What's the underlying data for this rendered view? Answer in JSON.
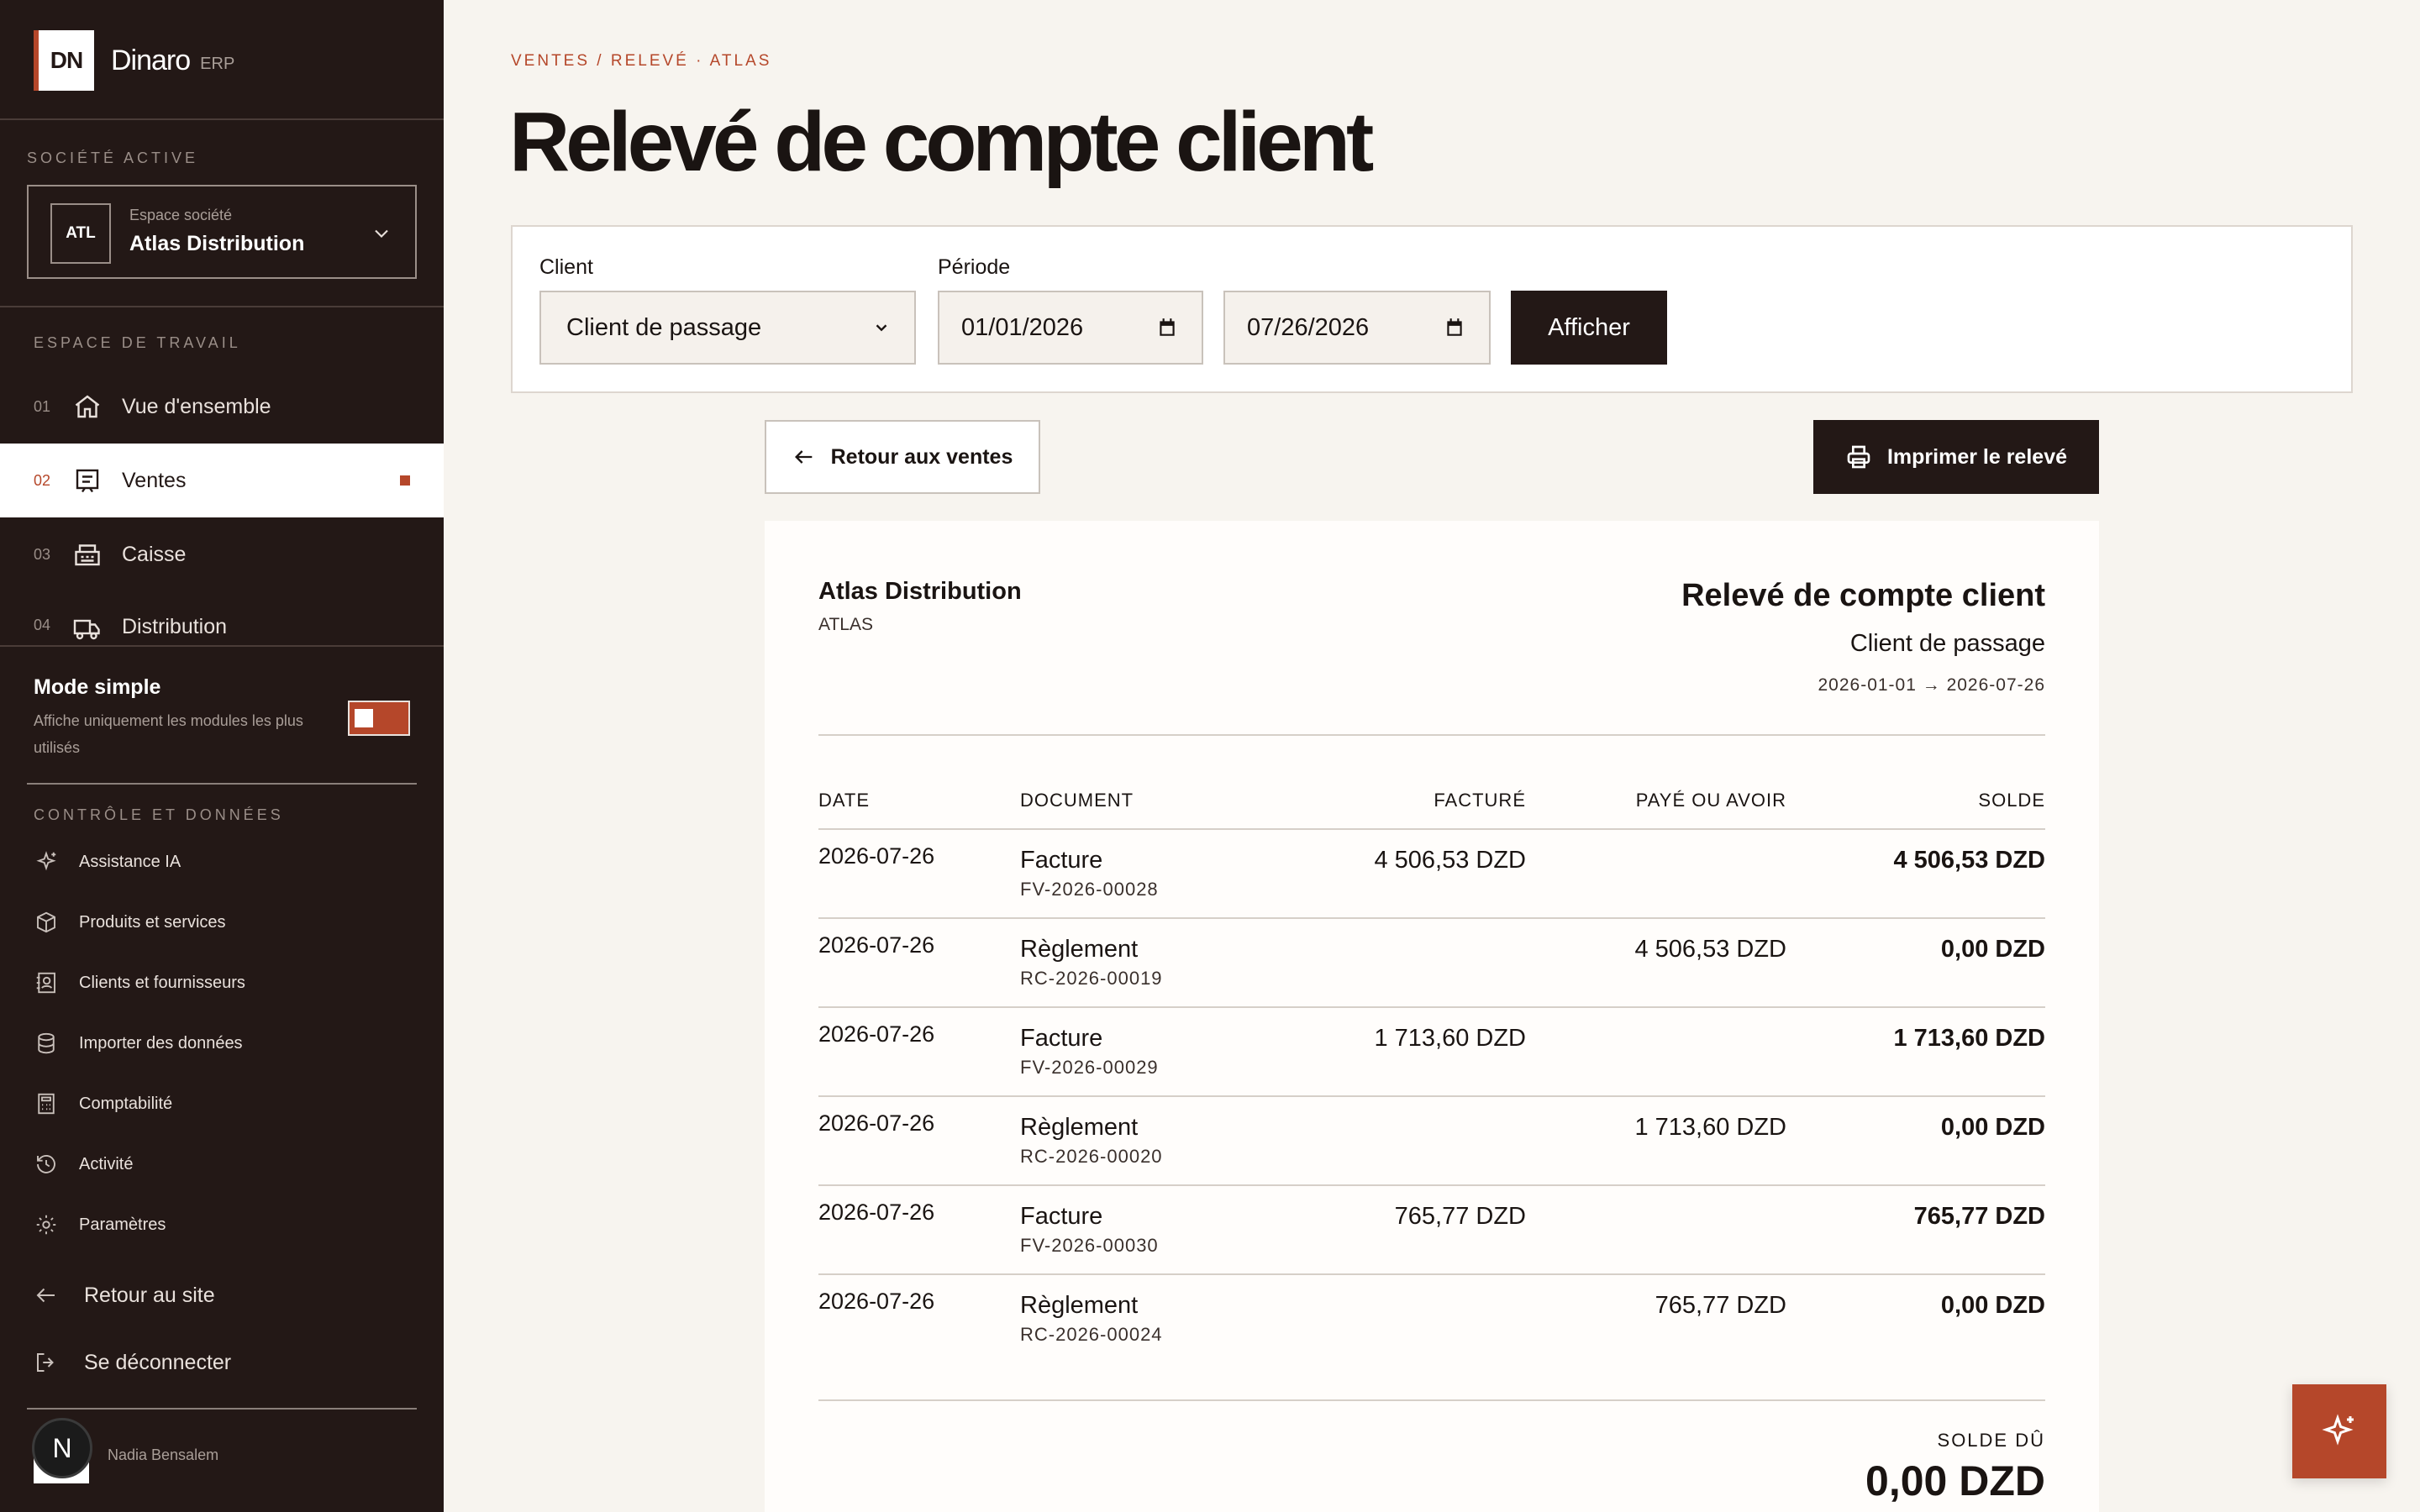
{
  "colors": {
    "accent": "#b5472a",
    "sidebar_bg": "#231816",
    "page_bg": "#f7f4ef"
  },
  "brand": {
    "logo": "DN",
    "name": "Dinaro",
    "tag": "ERP"
  },
  "company": {
    "section_label": "SOCIÉTÉ ACTIVE",
    "badge": "ATL",
    "sub": "Espace société",
    "name": "Atlas Distribution",
    "icon": "chevron-down-icon"
  },
  "workspace": {
    "section_label": "ESPACE DE TRAVAIL",
    "items": [
      {
        "num": "01",
        "label": "Vue d'ensemble",
        "icon": "home-icon"
      },
      {
        "num": "02",
        "label": "Ventes",
        "icon": "receipt-icon",
        "active": true
      },
      {
        "num": "03",
        "label": "Caisse",
        "icon": "cash-register-icon"
      },
      {
        "num": "04",
        "label": "Distribution",
        "icon": "truck-icon"
      }
    ]
  },
  "mode": {
    "title": "Mode simple",
    "desc": "Affiche uniquement les modules les plus utilisés",
    "enabled": true
  },
  "controls": {
    "section_label": "CONTRÔLE ET DONNÉES",
    "items": [
      {
        "label": "Assistance IA",
        "icon": "sparkle-icon"
      },
      {
        "label": "Produits et services",
        "icon": "box-icon"
      },
      {
        "label": "Clients et fournisseurs",
        "icon": "contacts-icon"
      },
      {
        "label": "Importer des données",
        "icon": "database-icon"
      },
      {
        "label": "Comptabilité",
        "icon": "calculator-icon"
      },
      {
        "label": "Activité",
        "icon": "history-icon"
      },
      {
        "label": "Paramètres",
        "icon": "gear-icon"
      }
    ]
  },
  "footer_links": {
    "back_site": "Retour au site",
    "logout": "Se déconnecter"
  },
  "user": {
    "initial": "N",
    "name": "Nadia Bensalem"
  },
  "breadcrumb": "VENTES / RELEVÉ · ATLAS",
  "page_title": "Relevé de compte client",
  "filters": {
    "client_label": "Client",
    "client_value": "Client de passage",
    "period_label": "Période",
    "date_from": "01/01/2026",
    "date_to": "07/26/2026",
    "submit": "Afficher"
  },
  "actions": {
    "back": "Retour aux ventes",
    "print": "Imprimer le relevé"
  },
  "statement": {
    "company": "Atlas Distribution",
    "code": "ATLAS",
    "title": "Relevé de compte client",
    "client": "Client de passage",
    "period": "2026-01-01 → 2026-07-26",
    "headers": {
      "date": "DATE",
      "document": "DOCUMENT",
      "billed": "FACTURÉ",
      "paid": "PAYÉ OU AVOIR",
      "balance": "SOLDE"
    },
    "rows": [
      {
        "date": "2026-07-26",
        "doc": "Facture",
        "ref": "FV-2026-00028",
        "billed": "4 506,53 DZD",
        "paid": "",
        "balance": "4 506,53 DZD"
      },
      {
        "date": "2026-07-26",
        "doc": "Règlement",
        "ref": "RC-2026-00019",
        "billed": "",
        "paid": "4 506,53 DZD",
        "balance": "0,00 DZD"
      },
      {
        "date": "2026-07-26",
        "doc": "Facture",
        "ref": "FV-2026-00029",
        "billed": "1 713,60 DZD",
        "paid": "",
        "balance": "1 713,60 DZD"
      },
      {
        "date": "2026-07-26",
        "doc": "Règlement",
        "ref": "RC-2026-00020",
        "billed": "",
        "paid": "1 713,60 DZD",
        "balance": "0,00 DZD"
      },
      {
        "date": "2026-07-26",
        "doc": "Facture",
        "ref": "FV-2026-00030",
        "billed": "765,77 DZD",
        "paid": "",
        "balance": "765,77 DZD"
      },
      {
        "date": "2026-07-26",
        "doc": "Règlement",
        "ref": "RC-2026-00024",
        "billed": "",
        "paid": "765,77 DZD",
        "balance": "0,00 DZD"
      }
    ],
    "due_label": "SOLDE DÛ",
    "due_value": "0,00 DZD"
  }
}
